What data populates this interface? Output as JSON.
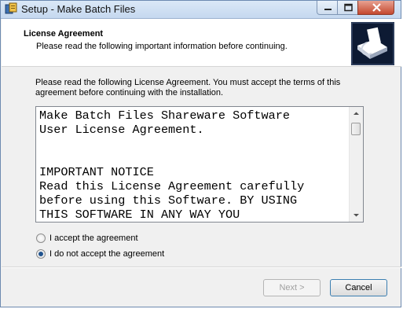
{
  "window": {
    "title": "Setup - Make Batch Files",
    "app_icon": "installer-icon",
    "controls": [
      "minimize-icon",
      "maximize-icon",
      "close-icon"
    ]
  },
  "header": {
    "title": "License Agreement",
    "subtitle": "Please read the following important information before continuing.",
    "icon": "setup-wizard-icon"
  },
  "instructions": "Please read the following License Agreement. You must accept the terms of this agreement before continuing with the installation.",
  "license": {
    "text": "Make Batch Files Shareware Software\nUser License Agreement.\n\n\nIMPORTANT NOTICE\nRead this License Agreement carefully\nbefore using this Software. BY USING\nTHIS SOFTWARE IN ANY WAY YOU"
  },
  "options": [
    {
      "label": "I accept the agreement",
      "selected": false
    },
    {
      "label": "I do not accept the agreement",
      "selected": true
    }
  ],
  "buttons": {
    "next": "Next >",
    "next_enabled": false,
    "cancel": "Cancel"
  }
}
